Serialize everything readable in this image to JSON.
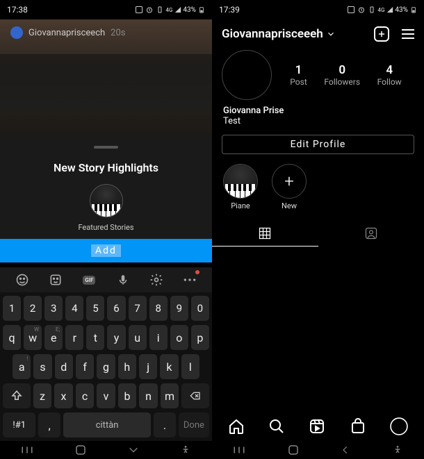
{
  "left": {
    "status": {
      "time": "17:38",
      "battery_text": "43%"
    },
    "story": {
      "username": "Giovannaprisceech",
      "age": "20s"
    },
    "drawer": {
      "title": "New Story Highlights",
      "featured_label": "Featured Stories",
      "add_label": "Add"
    },
    "keyboard": {
      "toolbar": {
        "gif": "GIF"
      },
      "row_nums": [
        "1",
        "2",
        "3",
        "4",
        "5",
        "6",
        "7",
        "8",
        "9",
        "0"
      ],
      "row_q": [
        "q",
        "w",
        "e",
        "r",
        "t",
        "y",
        "u",
        "i",
        "o",
        "p"
      ],
      "row_q_subs": [
        "",
        "W",
        "E;",
        "",
        "",
        "",
        "",
        "",
        "",
        ""
      ],
      "row_a": [
        "a",
        "s",
        "d",
        "f",
        "g",
        "h",
        "j",
        "k",
        "l"
      ],
      "row_a_sub": "!",
      "row_z": [
        "z",
        "x",
        "c",
        "v",
        "b",
        "n",
        "m"
      ],
      "bottom": {
        "symbols": "!#1",
        "comma": ",",
        "space": "cittàn",
        "period": ".",
        "done": "Done"
      }
    }
  },
  "right": {
    "status": {
      "time": "17:39",
      "battery_text": "43%"
    },
    "header": {
      "username": "Giovannaprisceeeh"
    },
    "stats": {
      "posts": {
        "num": "1",
        "label": "Post"
      },
      "followers": {
        "num": "0",
        "label": "Followers"
      },
      "following": {
        "num": "4",
        "label": "Follow"
      }
    },
    "bio": {
      "name": "Giovanna Prise",
      "line": "Test"
    },
    "edit_label": "Edit Profile",
    "highlights": {
      "piano_label": "Piane",
      "new_label": "New"
    }
  }
}
